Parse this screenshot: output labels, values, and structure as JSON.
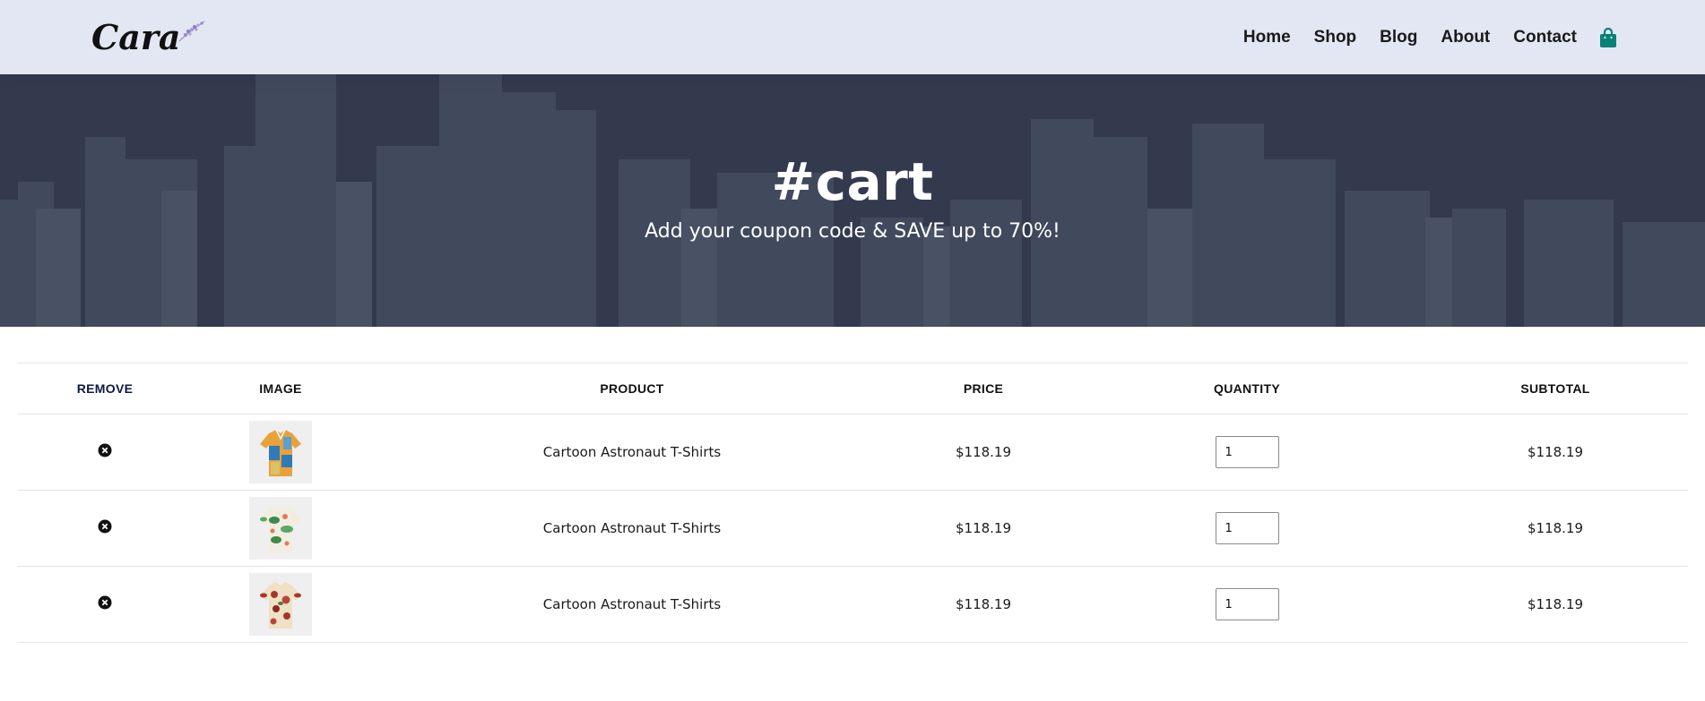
{
  "brand": {
    "logo_text": "Cara"
  },
  "nav": {
    "items": [
      {
        "label": "Home"
      },
      {
        "label": "Shop"
      },
      {
        "label": "Blog"
      },
      {
        "label": "About"
      },
      {
        "label": "Contact"
      }
    ],
    "cart_icon": "shopping-bag-icon"
  },
  "hero": {
    "title": "#cart",
    "subtitle": "Add your coupon code & SAVE up to 70%!"
  },
  "table": {
    "headers": {
      "remove": "Remove",
      "image": "Image",
      "product": "Product",
      "price": "Price",
      "quantity": "Quantity",
      "subtotal": "Subtotal"
    },
    "rows": [
      {
        "product": "Cartoon Astronaut T-Shirts",
        "price": "$118.19",
        "quantity": "1",
        "subtotal": "$118.19",
        "image_icon": "shirt-image-orange-blue"
      },
      {
        "product": "Cartoon Astronaut T-Shirts",
        "price": "$118.19",
        "quantity": "1",
        "subtotal": "$118.19",
        "image_icon": "shirt-image-green-floral"
      },
      {
        "product": "Cartoon Astronaut T-Shirts",
        "price": "$118.19",
        "quantity": "1",
        "subtotal": "$118.19",
        "image_icon": "shirt-image-red-floral"
      }
    ]
  },
  "colors": {
    "header_bg": "#e3e6f3",
    "accent": "#088178",
    "hero_overlay": "#2d3447",
    "remove_header": "#0d1a40"
  }
}
